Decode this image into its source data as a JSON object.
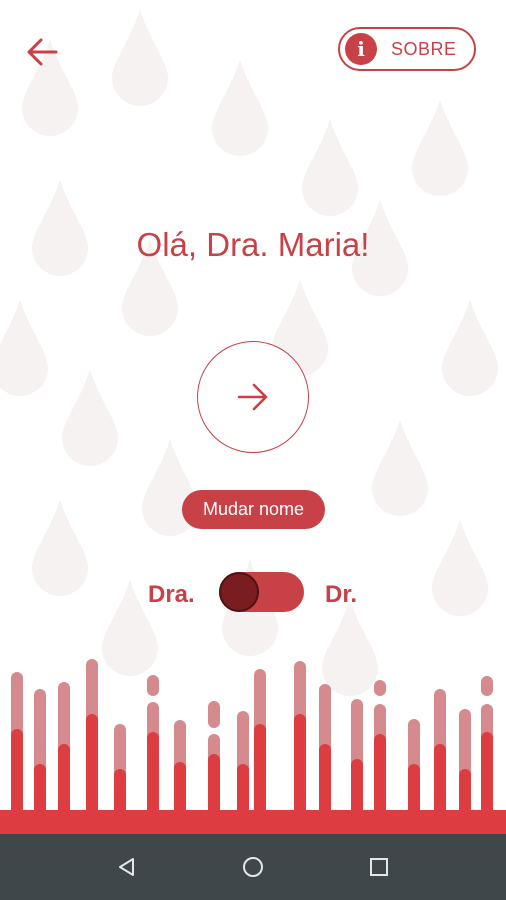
{
  "header": {
    "back_icon": "arrow-left-icon",
    "about_label": "SOBRE",
    "about_icon": "info-icon"
  },
  "main": {
    "greeting": "Olá, Dra. Maria!",
    "continue_icon": "arrow-right-icon",
    "rename_label": "Mudar nome"
  },
  "title_toggle": {
    "left_label": "Dra.",
    "right_label": "Dr.",
    "selected": "Dra."
  },
  "navbar": {
    "back_icon": "triangle-back-icon",
    "home_icon": "circle-home-icon",
    "recents_icon": "square-recents-icon"
  },
  "colors": {
    "accent": "#c84147",
    "accent_dark": "#7a1d21",
    "wave_light": "#d58a8d",
    "wave_strong": "#dd3c40",
    "navbar": "#3f474b",
    "drop_bg": "#f7f3f3"
  }
}
